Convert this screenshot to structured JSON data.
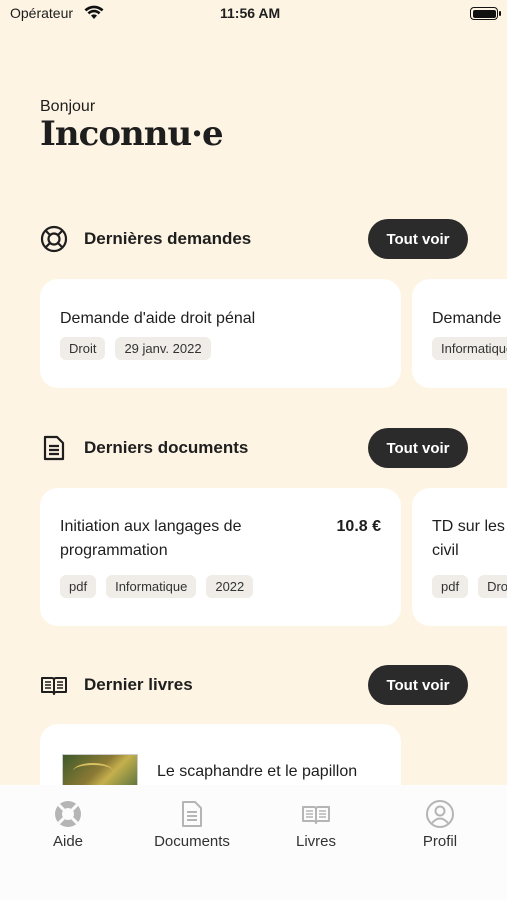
{
  "status_bar": {
    "carrier": "Opérateur",
    "time": "11:56 AM"
  },
  "header": {
    "greeting": "Bonjour",
    "username": "Inconnu·e"
  },
  "sections": {
    "requests": {
      "title": "Dernières demandes",
      "see_all": "Tout voir",
      "cards": [
        {
          "title": "Demande d'aide droit pénal",
          "tags": [
            "Droit",
            "29 janv. 2022"
          ]
        },
        {
          "title": "Demande",
          "tags": [
            "Informatique"
          ]
        }
      ]
    },
    "documents": {
      "title": "Derniers documents",
      "see_all": "Tout voir",
      "cards": [
        {
          "title": "Initiation aux langages de programmation",
          "price": "10.8 €",
          "tags": [
            "pdf",
            "Informatique",
            "2022"
          ]
        },
        {
          "title": "TD sur les civil",
          "tags": [
            "pdf",
            "Dro"
          ]
        }
      ]
    },
    "books": {
      "title": "Dernier livres",
      "see_all": "Tout voir",
      "cards": [
        {
          "title": "Le scaphandre et le papillon"
        }
      ]
    }
  },
  "tabbar": {
    "items": [
      {
        "label": "Aide",
        "icon": "lifebuoy-icon"
      },
      {
        "label": "Documents",
        "icon": "document-icon"
      },
      {
        "label": "Livres",
        "icon": "book-icon"
      },
      {
        "label": "Profil",
        "icon": "user-icon"
      }
    ]
  }
}
